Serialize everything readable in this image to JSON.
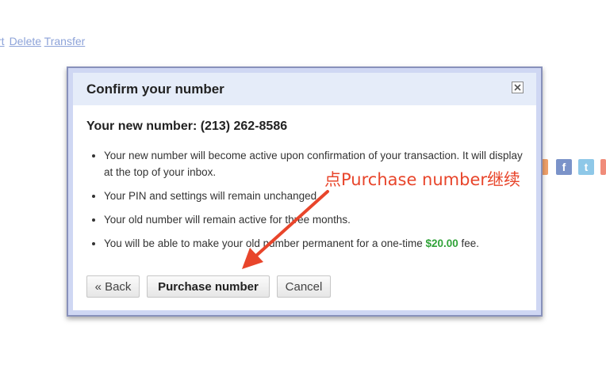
{
  "top_links": {
    "partial": "rt",
    "delete": "Delete",
    "transfer": "Transfer"
  },
  "social_icons": [
    {
      "icon": "orange-partial-icon",
      "color": "#f0a16a"
    },
    {
      "icon": "facebook-icon",
      "glyph": "f",
      "color": "#7b93c9"
    },
    {
      "icon": "twitter-icon",
      "glyph": "t",
      "color": "#8ec8e8"
    },
    {
      "icon": "red-partial-icon",
      "color": "#f08c7a"
    }
  ],
  "dialog": {
    "title": "Confirm your number",
    "subheading": "Your new number: (213) 262-8586",
    "bullets": [
      "Your new number will become active upon confirmation of your transaction. It will display at the top of your inbox.",
      "Your PIN and settings will remain unchanged.",
      "Your old number will remain active for three months."
    ],
    "last_bullet": {
      "before": "You will be able to make your old number permanent for a one-time ",
      "price": "$20.00",
      "after": " fee."
    },
    "buttons": {
      "back": "« Back",
      "purchase": "Purchase number",
      "cancel": "Cancel"
    }
  },
  "annotation": {
    "text": "点Purchase number继续",
    "color": "#e8452b"
  }
}
